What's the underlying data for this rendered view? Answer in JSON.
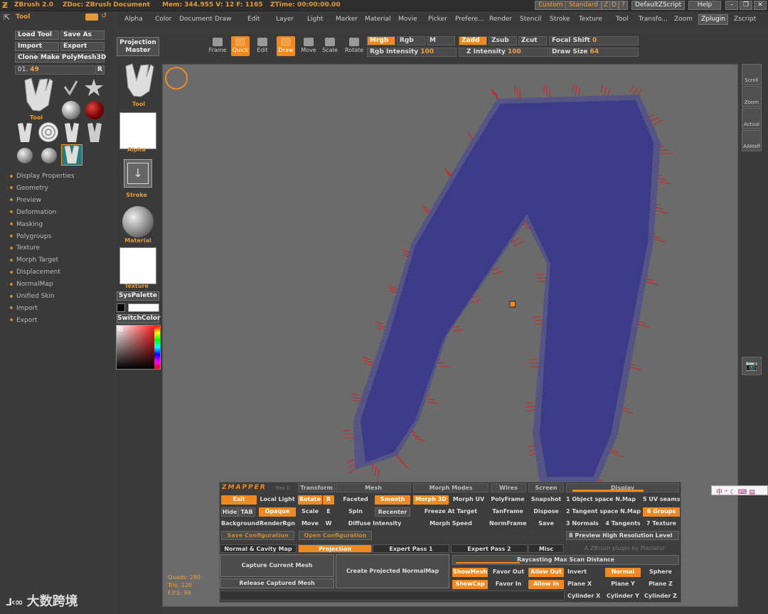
{
  "titlebar": {
    "app": "ZBrush 2.0",
    "doc": "ZDoc: ZBrush Document",
    "mem": "Mem: 344.955 V: 12 F: 1165",
    "ztime": "ZTime: 00:00:00.00",
    "custom": "Custom",
    "standard": "Standard",
    "z": "Z",
    "d": "D",
    "q": "?",
    "script": "DefaultZScript",
    "help": "Help"
  },
  "menus": [
    "Alpha",
    "Color",
    "Document",
    "Draw",
    "Edit",
    "Layer",
    "Light",
    "Marker",
    "Material",
    "Movie",
    "Picker",
    "Prefere...",
    "Render",
    "Stencil",
    "Stroke",
    "Texture",
    "Tool",
    "Transfo...",
    "Zoom",
    "Zplugin",
    "Zscript"
  ],
  "menu_selected": "Zplugin",
  "leftpanel": {
    "title": "Tool",
    "load": "Load Tool",
    "save": "Save As",
    "import": "Import",
    "export": "Export",
    "clone": "Clone",
    "polymesh": "Make PolyMesh3D",
    "slider_label": "01.",
    "slider_value": "49",
    "r": "R",
    "tool_label": "Tool",
    "sections": [
      "Display Properties",
      "Geometry",
      "Preview",
      "Deformation",
      "Masking",
      "Polygroups",
      "Texture",
      "Morph Target",
      "Displacement",
      "NormalMap",
      "Unified Skin",
      "Import",
      "Export"
    ]
  },
  "midcol": {
    "projection": "Projection",
    "master": "Master",
    "tool": "Tool",
    "alpha": "Alpha",
    "stroke": "Stroke",
    "material": "Material",
    "texture": "Texture",
    "syspalette": "SysPalette",
    "switchcolor": "SwitchColor"
  },
  "shelf": {
    "tools": [
      "Frame",
      "Quick",
      "Edit",
      "Draw",
      "Move",
      "Scale",
      "Rotate"
    ],
    "mrgb": "Mrgb",
    "rgb": "Rgb",
    "m": "M",
    "zadd": "Zadd",
    "zsub": "Zsub",
    "zcut": "Zcut",
    "focal": "Focal Shift",
    "focal_val": "0",
    "rgb_int": "Rgb Intensity",
    "rgb_int_val": "100",
    "z_int": "Z Intensity",
    "z_int_val": "100",
    "draw_size": "Draw Size",
    "draw_size_val": "64"
  },
  "rightcol": [
    "Scroll",
    "Zoom",
    "Actual",
    "AAHalf"
  ],
  "stats": {
    "quads": "Quads: 280",
    "tris": "Tris: 120",
    "fps": "F.P.S: 99"
  },
  "zmapper": {
    "logo": "ZMAPPER",
    "rev": "Rev D",
    "headers": [
      "Transform",
      "Mesh",
      "Morph Modes",
      "Wires",
      "Screen",
      "Display"
    ],
    "row1": [
      "Exit",
      "Local Light",
      "Rotate",
      "R",
      "Faceted",
      "Smooth",
      "Morph 3D",
      "Morph UV",
      "PolyFrame",
      "Snapshot",
      "1 Object space N.Map",
      "5 UV seams"
    ],
    "row2": [
      "Hide",
      "TAB",
      "Opaque",
      "Scale",
      "E",
      "Spin",
      "Recenter",
      "Freeze At Target",
      "TanFrame",
      "Dispose",
      "2 Tangent space N.Map",
      "6 Groups"
    ],
    "row3": [
      "Background",
      "RenderRgn",
      "Move",
      "W",
      "Diffuse Intensity",
      "Morph Speed",
      "NormFrame",
      "Save",
      "3 Normals",
      "4 Tangents",
      "7 Texture"
    ],
    "save_conf": "Save Configuration",
    "open_conf": "Open Configuration",
    "preview_hr": "8 Preview High Resolution Level",
    "tabs": [
      "Normal & Cavity Map",
      "Projection",
      "Expert Pass 1",
      "Expert Pass 2",
      "Misc"
    ],
    "credit": "A ZBrush plugin by Pixolator",
    "capture": "Capture Current Mesh",
    "release": "Release Captured Mesh",
    "create": "Create Projected NormalMap",
    "raycast": "Raycasting Max Scan Distance",
    "showmesh": "ShowMesh",
    "showcap": "ShowCap",
    "favor_out": "Favor Out",
    "favor_in": "Favor In",
    "allow_out": "Allow Out",
    "allow_in": "Allow In",
    "invert": "Invert",
    "normal": "Normal",
    "sphere": "Sphere",
    "planex": "Plane X",
    "planey": "Plane Y",
    "planez": "Plane Z",
    "cylx": "Cylinder X",
    "cyly": "Cylinder Y",
    "cylz": "Cylinder Z"
  },
  "watermark": "大数跨境",
  "colors": {
    "accent": "#f08a20",
    "mesh": "#3d3a8a",
    "normals": "#d42020"
  }
}
